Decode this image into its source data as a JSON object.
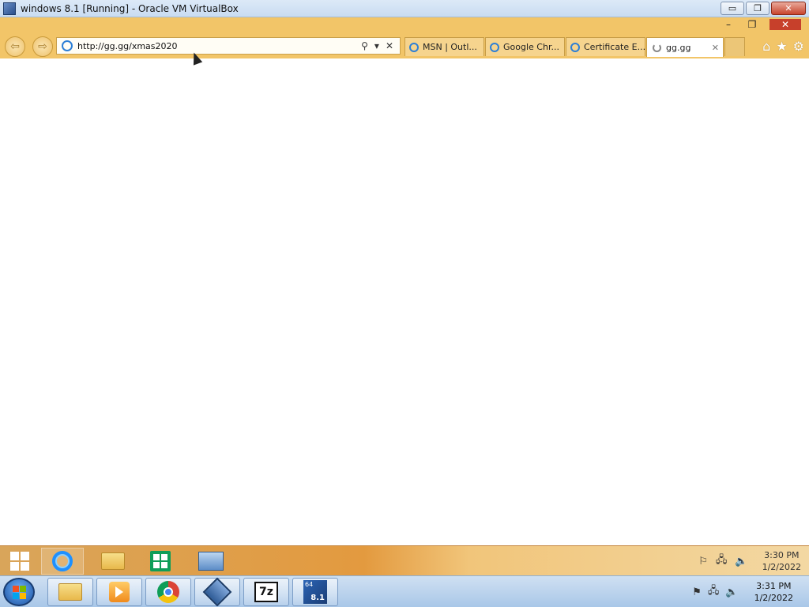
{
  "host_window": {
    "title": "windows 8.1 [Running] - Oracle VM VirtualBox",
    "controls": {
      "minimize": "▭",
      "restore": "❐",
      "close": "✕"
    }
  },
  "ie": {
    "window_controls": {
      "minimize": "–",
      "restore": "❐",
      "close": "✕"
    },
    "url": "http://gg.gg/xmas2020",
    "tabs": [
      {
        "label": "MSN | Outl..."
      },
      {
        "label": "Google Chr..."
      },
      {
        "label": "Certificate E..."
      },
      {
        "label": "gg.gg"
      }
    ],
    "tab_close": "✕"
  },
  "guest_taskbar": {
    "time": "3:30 PM",
    "date": "1/2/2022"
  },
  "host_taskbar": {
    "time": "3:31 PM",
    "date": "1/2/2022",
    "sevenzip_label": "7z",
    "win81_top": "64",
    "win81_bottom": "8.1"
  },
  "colors": {
    "ie_frame": "#f2c568",
    "guest_taskbar": "#e39a3f",
    "host_taskbar": "#a9c7e8"
  }
}
